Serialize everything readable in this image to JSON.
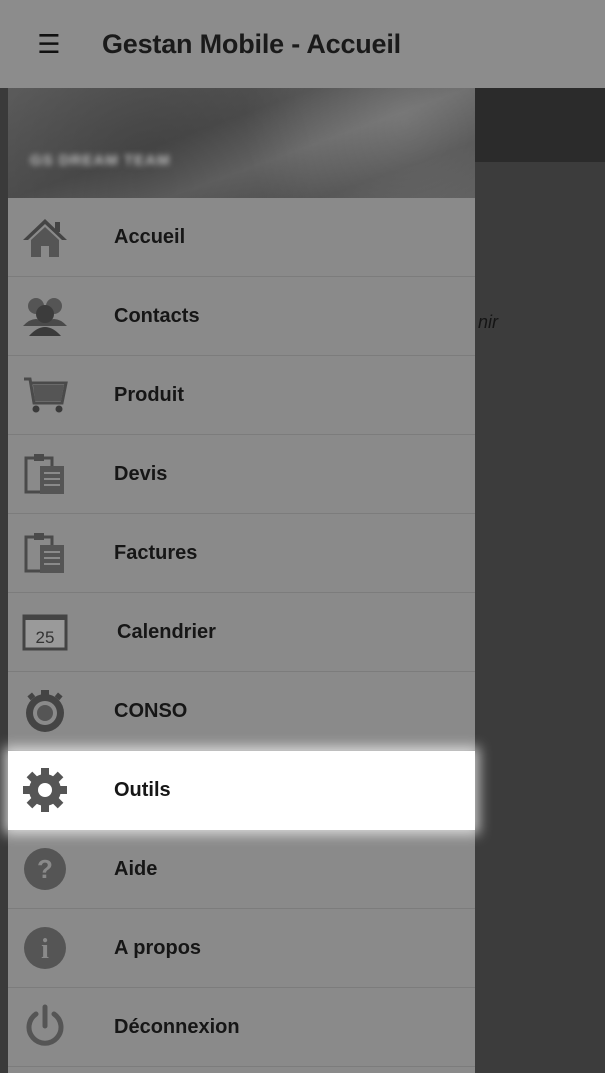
{
  "appbar": {
    "menu_icon": "hamburger-icon",
    "title": "Gestan Mobile - Accueil"
  },
  "background_content": {
    "snippet": "nir"
  },
  "drawer": {
    "header": {
      "team_label": "GS DREAM TEAM"
    },
    "items": [
      {
        "label": "Accueil",
        "icon": "home-icon"
      },
      {
        "label": "Contacts",
        "icon": "contacts-icon"
      },
      {
        "label": "Produit",
        "icon": "cart-icon"
      },
      {
        "label": "Devis",
        "icon": "clipboard-icon"
      },
      {
        "label": "Factures",
        "icon": "clipboard-icon"
      },
      {
        "label": "Calendrier",
        "icon": "calendar-icon",
        "icon_text": "25"
      },
      {
        "label": "CONSO",
        "icon": "timer-icon"
      },
      {
        "label": "Outils",
        "icon": "gear-icon",
        "active": true
      },
      {
        "label": "Aide",
        "icon": "help-icon",
        "icon_text": "?"
      },
      {
        "label": "A propos",
        "icon": "info-icon",
        "icon_text": "i"
      },
      {
        "label": "Déconnexion",
        "icon": "power-icon"
      }
    ]
  }
}
